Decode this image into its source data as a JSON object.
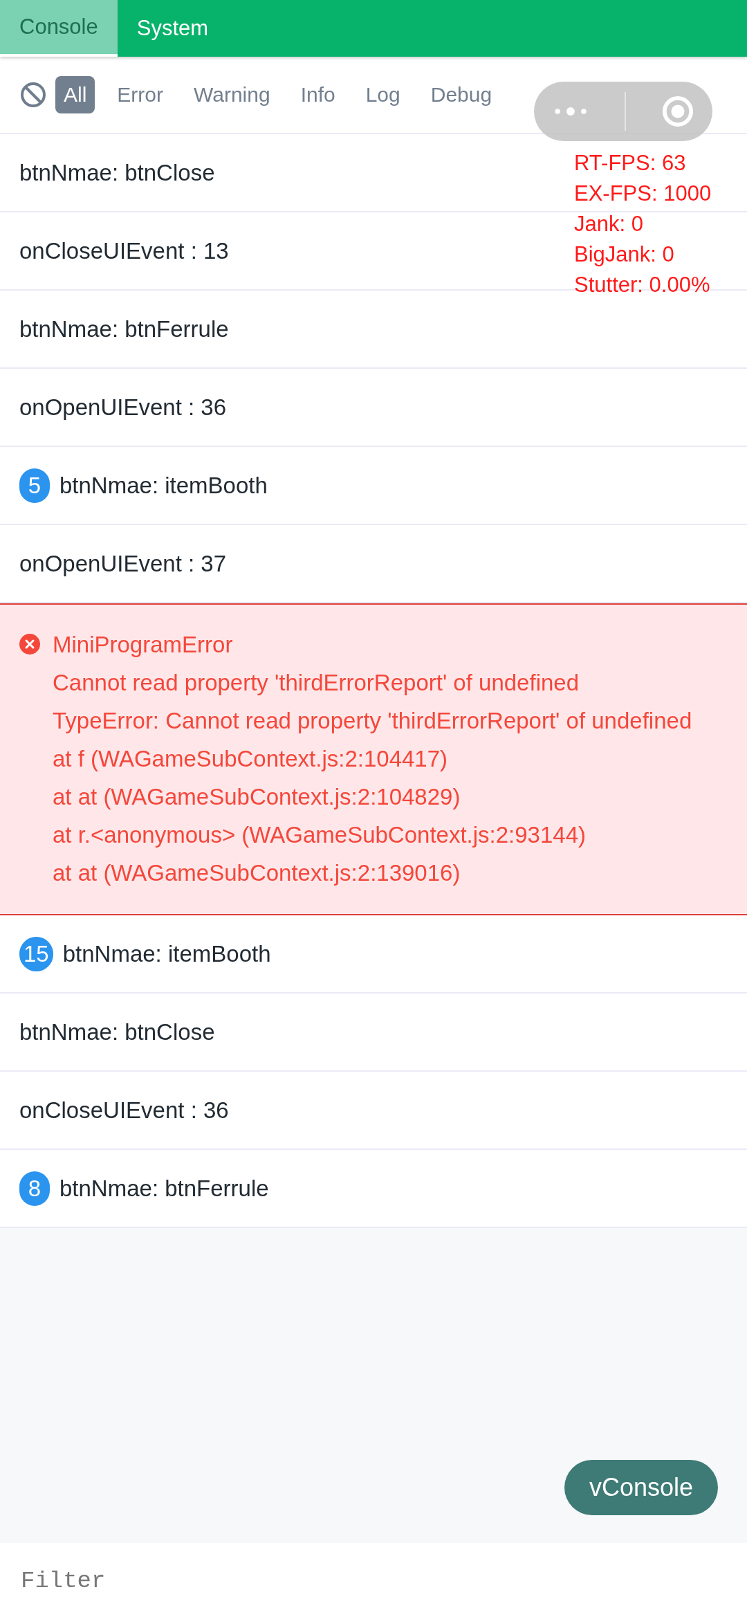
{
  "tabs": [
    {
      "label": "Console",
      "selected": true
    },
    {
      "label": "System",
      "selected": false
    }
  ],
  "filters": [
    {
      "label": "All",
      "selected": true
    },
    {
      "label": "Error",
      "selected": false
    },
    {
      "label": "Warning",
      "selected": false
    },
    {
      "label": "Info",
      "selected": false
    },
    {
      "label": "Log",
      "selected": false
    },
    {
      "label": "Debug",
      "selected": false
    }
  ],
  "perf_overlay": [
    "RT-FPS: 63",
    "EX-FPS: 1000",
    "Jank: 0",
    "BigJank: 0",
    "Stutter: 0.00%"
  ],
  "logs": [
    {
      "kind": "log",
      "text": "btnNmae:  btnClose"
    },
    {
      "kind": "log",
      "text": "onCloseUIEvent :  13"
    },
    {
      "kind": "log",
      "text": "btnNmae:  btnFerrule"
    },
    {
      "kind": "log",
      "text": "onOpenUIEvent :  36"
    },
    {
      "kind": "log",
      "repeat": "5",
      "text": "btnNmae:  itemBooth"
    },
    {
      "kind": "log",
      "text": "onOpenUIEvent :  37"
    },
    {
      "kind": "error",
      "text": "MiniProgramError",
      "details": [
        "Cannot read property 'thirdErrorReport' of undefined",
        "TypeError: Cannot read property 'thirdErrorReport' of undefined",
        "at f (WAGameSubContext.js:2:104417)",
        "at at (WAGameSubContext.js:2:104829)",
        "at r.<anonymous> (WAGameSubContext.js:2:93144)",
        "at at (WAGameSubContext.js:2:139016)"
      ]
    },
    {
      "kind": "log",
      "repeat": "15",
      "text": "btnNmae:  itemBooth"
    },
    {
      "kind": "log",
      "text": "btnNmae:  btnClose"
    },
    {
      "kind": "log",
      "text": "onCloseUIEvent :  36"
    },
    {
      "kind": "log",
      "repeat": "8",
      "text": "btnNmae:  btnFerrule"
    }
  ],
  "vconsole_button": "vConsole",
  "filter_input": {
    "placeholder": "Filter"
  }
}
